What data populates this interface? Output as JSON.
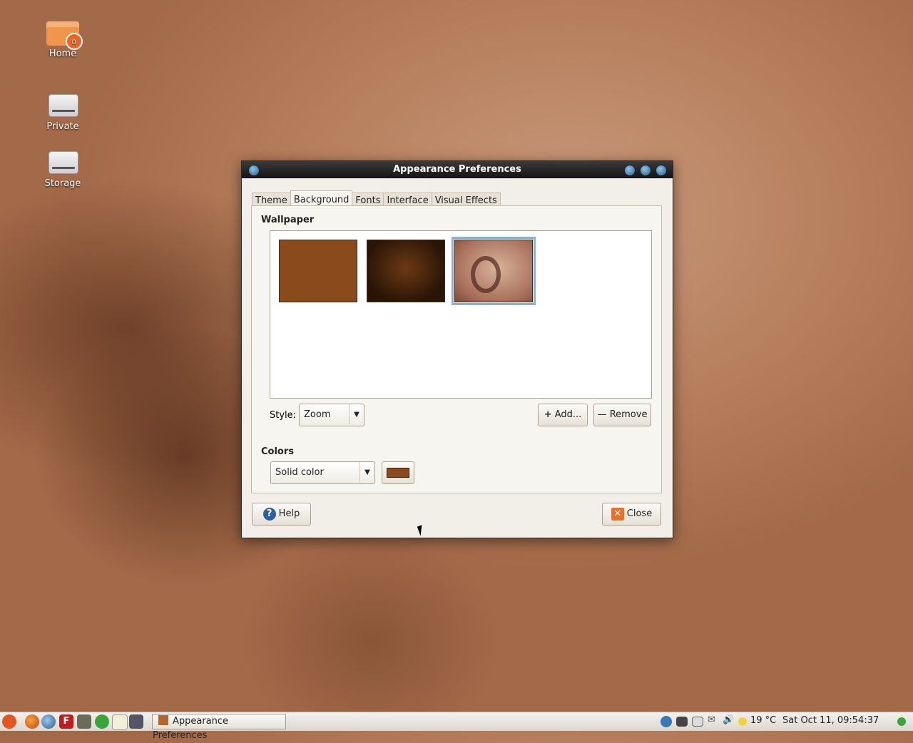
{
  "desktop": {
    "icons": [
      {
        "label": "Home"
      },
      {
        "label": "Private"
      },
      {
        "label": "Storage"
      }
    ]
  },
  "window": {
    "title": "Appearance Preferences",
    "tabs": [
      "Theme",
      "Background",
      "Fonts",
      "Interface",
      "Visual Effects"
    ],
    "active_tab": "Background",
    "wallpaper": {
      "title": "Wallpaper",
      "thumbnails": [
        {
          "name": "solid-brown",
          "color": "#8b4a1c"
        },
        {
          "name": "dark-grunge",
          "color": "#3a1f0c"
        },
        {
          "name": "ubuntu-grunge",
          "color": "#b07a5e",
          "selected": true
        }
      ],
      "style_label": "Style:",
      "style_value": "Zoom",
      "add_label": "Add...",
      "remove_label": "Remove"
    },
    "colors": {
      "title": "Colors",
      "mode_value": "Solid color",
      "swatch_color": "#8b4a1c"
    },
    "help_label": "Help",
    "close_label": "Close"
  },
  "taskbar": {
    "task_label": "Appearance Preferences",
    "temperature": "19 °C",
    "clock": "Sat Oct 11, 09:54:37"
  }
}
